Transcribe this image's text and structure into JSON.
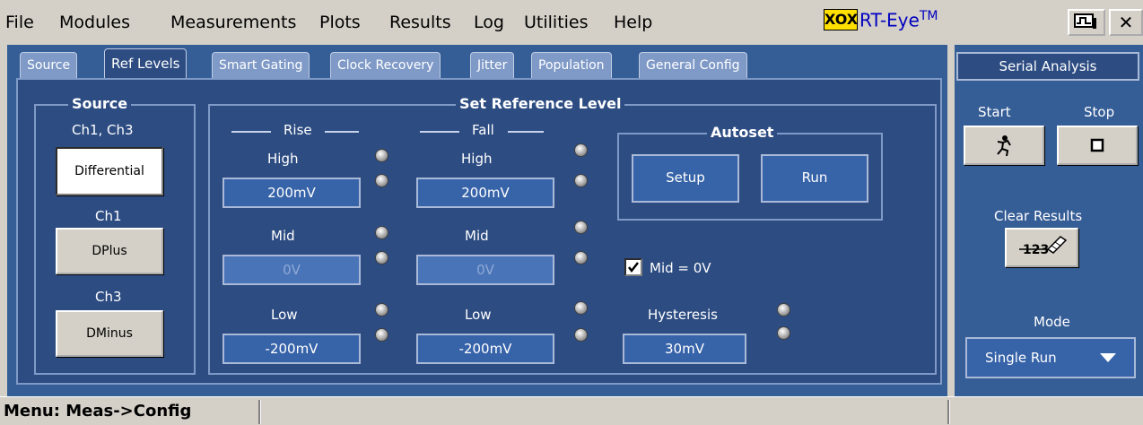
{
  "menu": {
    "items": [
      "File",
      "Modules",
      "Measurements",
      "Plots",
      "Results",
      "Log",
      "Utilities",
      "Help"
    ],
    "logo_box": "XOX",
    "app_title": "RT-Eye",
    "app_tm": "TM",
    "close": "✕"
  },
  "tabs": [
    "Source",
    "Ref Levels",
    "Smart Gating",
    "Clock Recovery",
    "Jitter",
    "Population",
    "General Config"
  ],
  "source": {
    "title": "Source",
    "ch13_label": "Ch1, Ch3",
    "differential": "Differential",
    "ch1_label": "Ch1",
    "dplus": "DPlus",
    "ch3_label": "Ch3",
    "dminus": "DMinus"
  },
  "ref_level": {
    "title": "Set Reference Level",
    "rise": {
      "header": "Rise",
      "high_label": "High",
      "high_value": "200mV",
      "mid_label": "Mid",
      "mid_value": "0V",
      "low_label": "Low",
      "low_value": "-200mV"
    },
    "fall": {
      "header": "Fall",
      "high_label": "High",
      "high_value": "200mV",
      "mid_label": "Mid",
      "mid_value": "0V",
      "low_label": "Low",
      "low_value": "-200mV"
    },
    "autoset": {
      "title": "Autoset",
      "setup": "Setup",
      "run": "Run"
    },
    "mid_zero": {
      "label": "Mid = 0V",
      "checked": true
    },
    "hysteresis": {
      "label": "Hysteresis",
      "value": "30mV"
    }
  },
  "serial": {
    "title": "Serial Analysis",
    "start_label": "Start",
    "stop_label": "Stop",
    "clear_label": "Clear Results",
    "mode_label": "Mode",
    "mode_value": "Single Run"
  },
  "status": {
    "text": "Menu: Meas->Config"
  },
  "colors": {
    "panel": "#355d96",
    "inner": "#2d4c82",
    "field": "#3763a8",
    "chrome": "#d4d0c8"
  }
}
